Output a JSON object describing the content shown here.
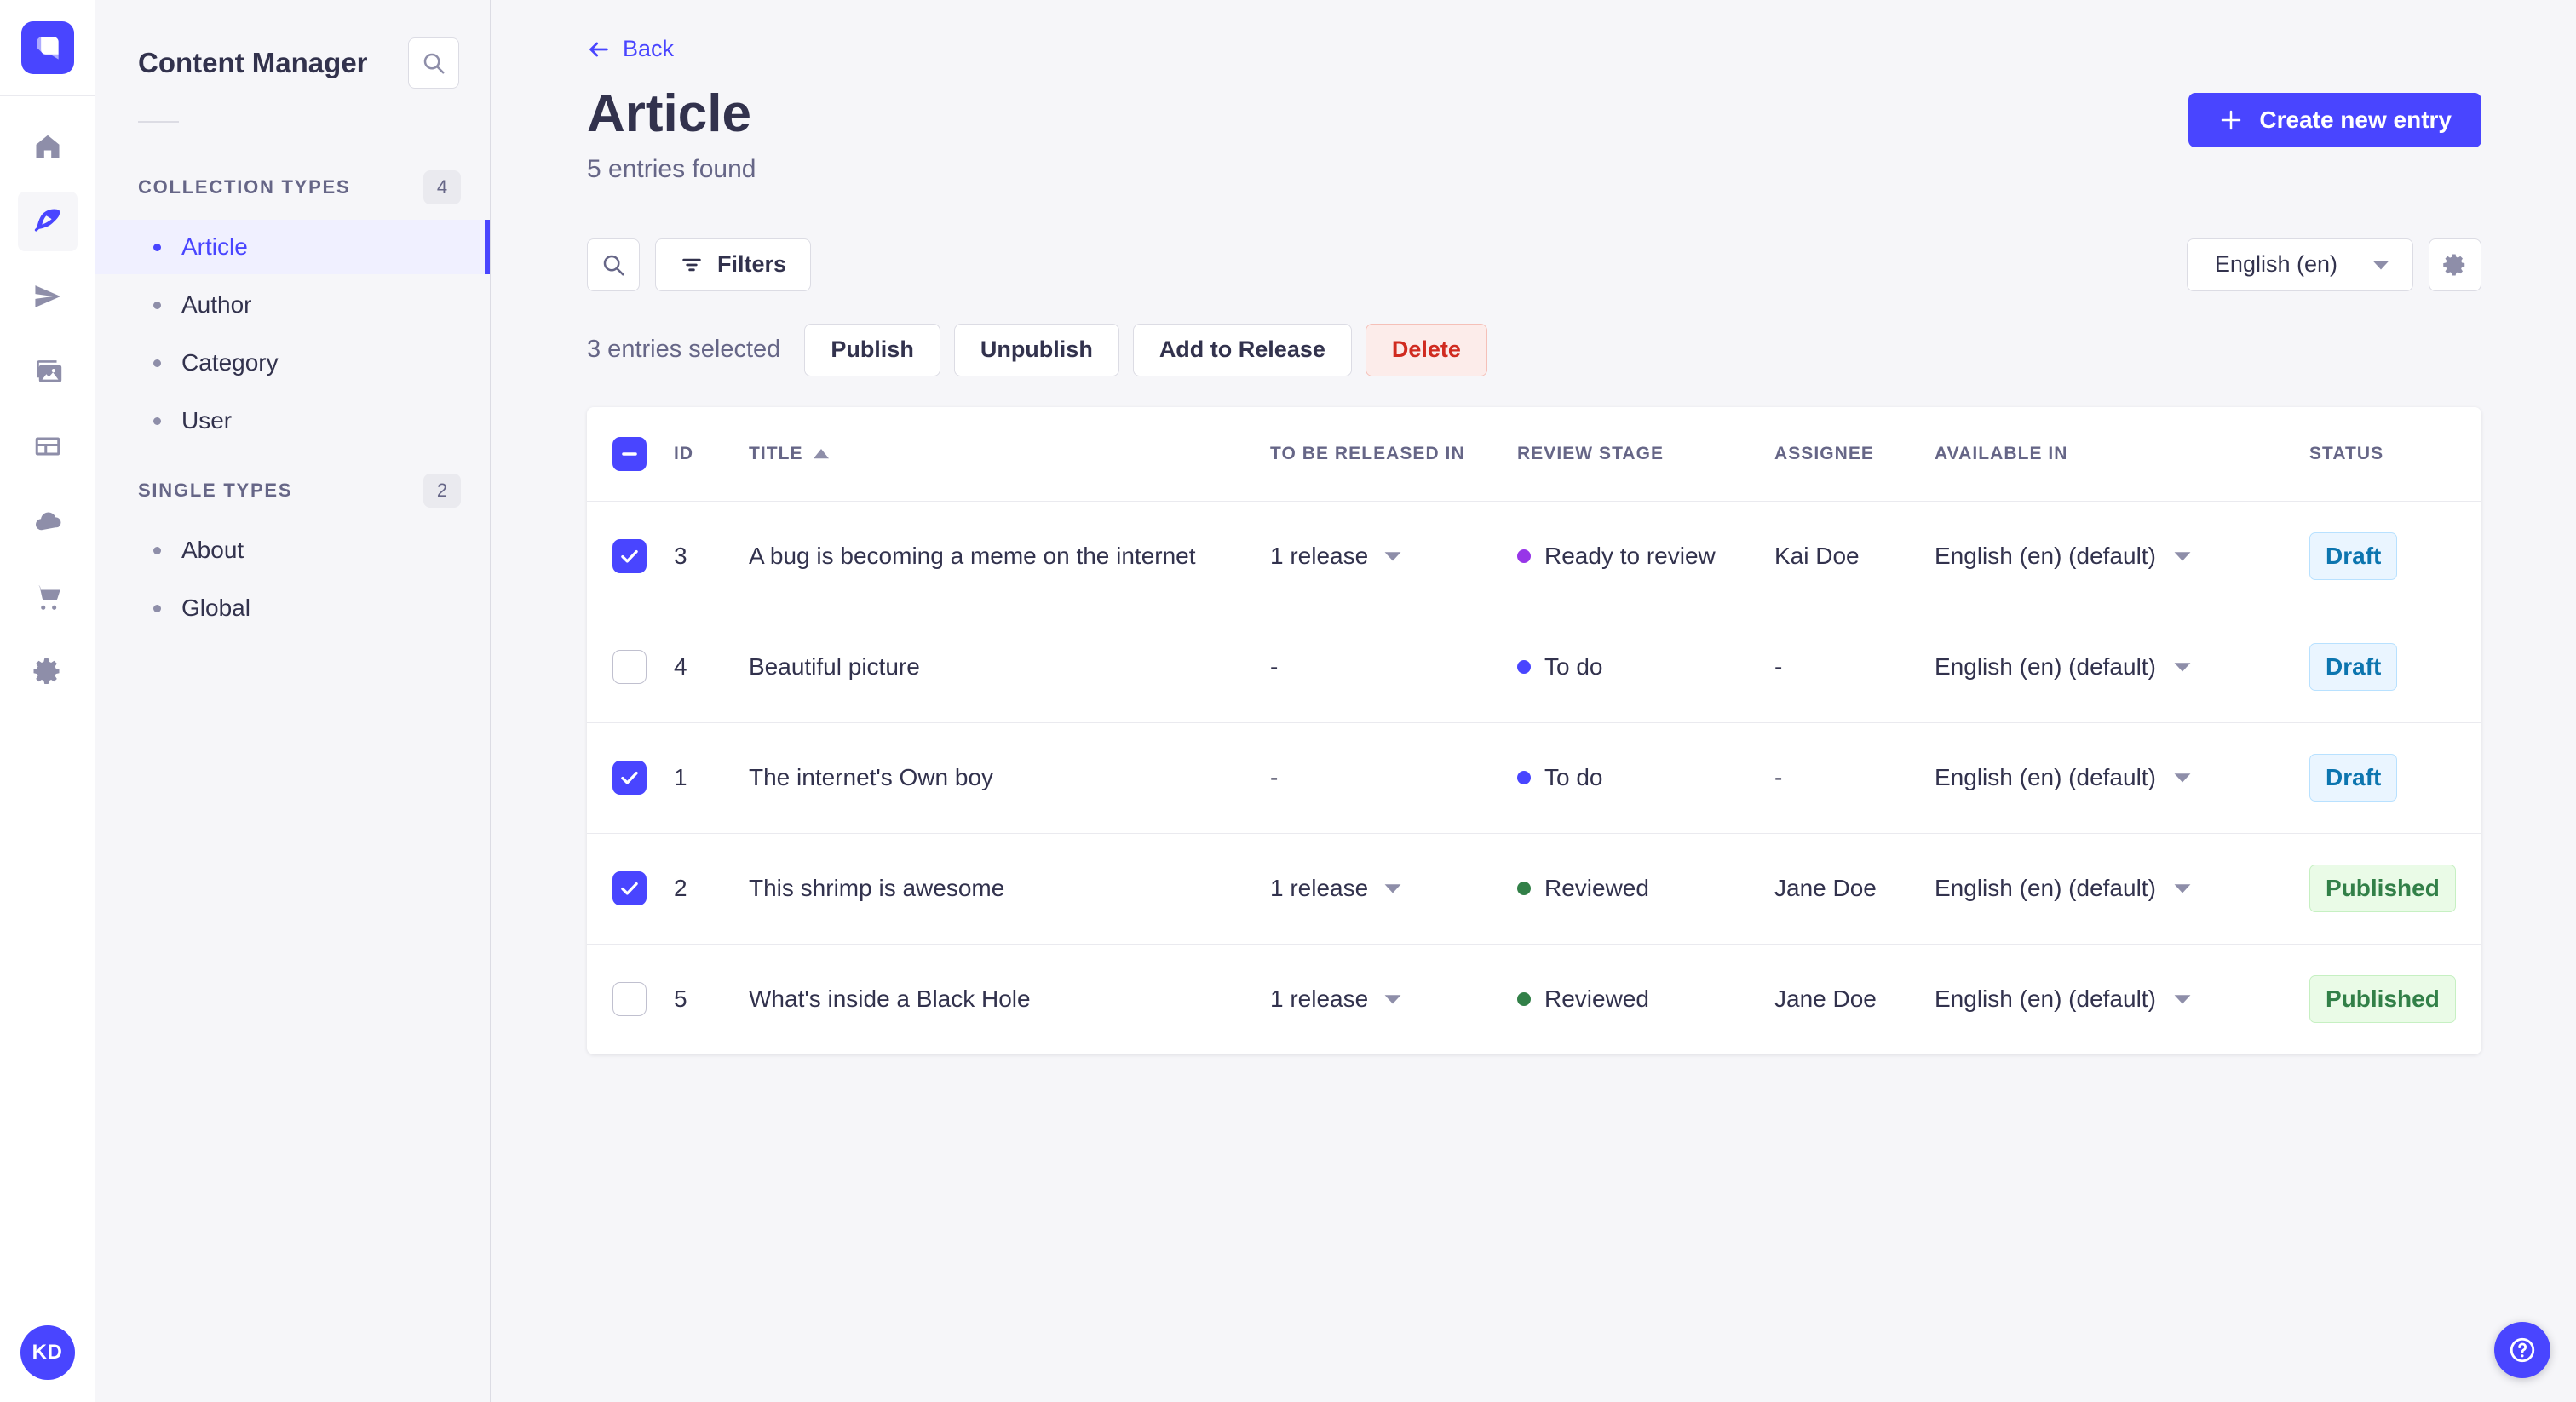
{
  "brand": {
    "accent": "#4945ff",
    "active_bg": "#f0f0ff",
    "danger": "#d02b20"
  },
  "nav": {
    "logo": "strapi-logo",
    "items": [
      {
        "name": "home",
        "active": false
      },
      {
        "name": "content",
        "active": true
      },
      {
        "name": "releases",
        "active": false
      },
      {
        "name": "media-library",
        "active": false
      },
      {
        "name": "content-type-builder",
        "active": false
      },
      {
        "name": "deploy",
        "active": false
      },
      {
        "name": "marketplace",
        "active": false
      },
      {
        "name": "settings",
        "active": false
      }
    ],
    "avatar_initials": "KD"
  },
  "subnav": {
    "title": "Content Manager",
    "search_icon": "search-icon",
    "sections": [
      {
        "label": "COLLECTION TYPES",
        "count": "4",
        "items": [
          {
            "label": "Article",
            "active": true
          },
          {
            "label": "Author",
            "active": false
          },
          {
            "label": "Category",
            "active": false
          },
          {
            "label": "User",
            "active": false
          }
        ]
      },
      {
        "label": "SINGLE TYPES",
        "count": "2",
        "items": [
          {
            "label": "About",
            "active": false
          },
          {
            "label": "Global",
            "active": false
          }
        ]
      }
    ]
  },
  "header": {
    "back_label": "Back",
    "title": "Article",
    "subtitle": "5 entries found",
    "create_button": "Create new entry"
  },
  "toolbar": {
    "filters_label": "Filters",
    "locale_value": "English (en)"
  },
  "selection": {
    "summary": "3 entries selected",
    "actions": [
      "Publish",
      "Unpublish",
      "Add to Release"
    ],
    "delete_label": "Delete"
  },
  "table": {
    "headers": [
      "ID",
      "TITLE",
      "TO BE RELEASED IN",
      "REVIEW STAGE",
      "ASSIGNEE",
      "AVAILABLE IN",
      "STATUS"
    ],
    "sorted_column": "TITLE",
    "sort_direction": "asc",
    "select_all_state": "indeterminate",
    "rows": [
      {
        "checked": true,
        "id": "3",
        "title": "A bug is becoming a meme on the internet",
        "release": "1 release",
        "stage": "Ready to review",
        "stage_color": "#9736e8",
        "assignee": "Kai Doe",
        "locale": "English (en) (default)",
        "status": "Draft"
      },
      {
        "checked": false,
        "id": "4",
        "title": "Beautiful picture",
        "release": "-",
        "stage": "To do",
        "stage_color": "#4945ff",
        "assignee": "-",
        "locale": "English (en) (default)",
        "status": "Draft"
      },
      {
        "checked": true,
        "id": "1",
        "title": "The internet's Own boy",
        "release": "-",
        "stage": "To do",
        "stage_color": "#4945ff",
        "assignee": "-",
        "locale": "English (en) (default)",
        "status": "Draft"
      },
      {
        "checked": true,
        "id": "2",
        "title": "This shrimp is awesome",
        "release": "1 release",
        "stage": "Reviewed",
        "stage_color": "#328048",
        "assignee": "Jane Doe",
        "locale": "English (en) (default)",
        "status": "Published"
      },
      {
        "checked": false,
        "id": "5",
        "title": "What's inside a Black Hole",
        "release": "1 release",
        "stage": "Reviewed",
        "stage_color": "#328048",
        "assignee": "Jane Doe",
        "locale": "English (en) (default)",
        "status": "Published"
      }
    ],
    "status_styles": {
      "Draft": {
        "bg": "#eaf5ff",
        "border": "#b8e1ff",
        "text": "#0c75af"
      },
      "Published": {
        "bg": "#eafbe7",
        "border": "#c6f0c2",
        "text": "#328048"
      }
    }
  },
  "fab": {
    "icon": "help-icon"
  }
}
